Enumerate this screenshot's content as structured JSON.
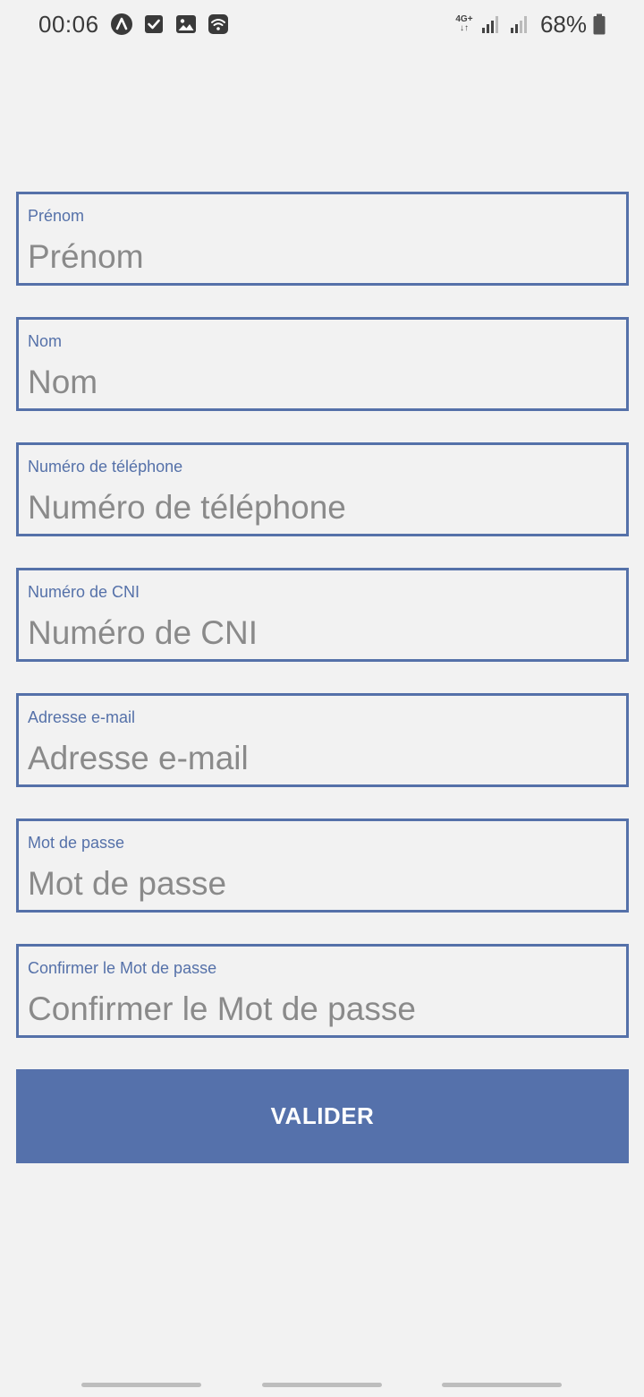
{
  "status_bar": {
    "time": "00:06",
    "left_icons": [
      "app-logo-icon",
      "checkbox-icon",
      "image-icon",
      "wifi-icon"
    ],
    "network_type_top": "4G+",
    "network_type_bottom": "↓↑",
    "battery_percent": "68%"
  },
  "form": {
    "fields": [
      {
        "label": "Prénom",
        "placeholder": "Prénom"
      },
      {
        "label": "Nom",
        "placeholder": "Nom"
      },
      {
        "label": "Numéro de téléphone",
        "placeholder": "Numéro de téléphone"
      },
      {
        "label": "Numéro de CNI",
        "placeholder": "Numéro de CNI"
      },
      {
        "label": "Adresse e-mail",
        "placeholder": "Adresse e-mail"
      },
      {
        "label": "Mot de passe",
        "placeholder": "Mot de passe"
      },
      {
        "label": "Confirmer le Mot de passe",
        "placeholder": "Confirmer le Mot de passe"
      }
    ],
    "submit_label": "VALIDER"
  },
  "colors": {
    "accent": "#5571a9",
    "background": "#f2f2f2",
    "placeholder": "#8a8a8a"
  }
}
